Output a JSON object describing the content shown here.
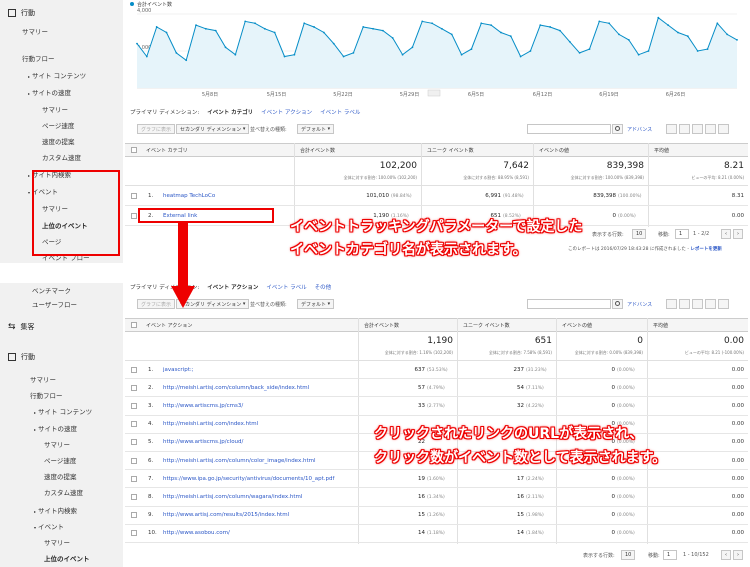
{
  "chart": {
    "legend": "合計イベント数",
    "y_ticks": [
      "4,000",
      "2,000"
    ],
    "x_ticks": [
      "5月8日",
      "5月15日",
      "5月22日",
      "5月29日",
      "6月5日",
      "6月12日",
      "6月19日",
      "6月26日"
    ]
  },
  "chart_data": {
    "type": "area",
    "title": "",
    "series": [
      {
        "name": "合計イベント数",
        "values": [
          2400,
          1700,
          3300,
          3000,
          1900,
          1500,
          3400,
          3200,
          3100,
          2200,
          1800,
          3600,
          3500,
          3200,
          3000,
          1700,
          1800,
          3500,
          3300,
          3000,
          2400,
          1700,
          1900,
          3300,
          3200,
          3100,
          2700,
          1800,
          2200,
          3600,
          3500,
          3200,
          2900,
          1800,
          2100,
          3500,
          3400,
          3000,
          2800,
          1700,
          2000,
          3400,
          3300,
          3100,
          2500,
          1900,
          2100,
          3600,
          3500,
          2900,
          2600,
          1800,
          2000,
          3800,
          3400,
          3000,
          2800,
          2000,
          2100,
          3500,
          2900,
          2600
        ]
      }
    ],
    "ylim": [
      0,
      4000
    ]
  },
  "sidebar_top": {
    "section_icon": "report-icon",
    "section": "行動",
    "items": [
      "サマリー",
      "行動フロー",
      "サイト コンテンツ",
      "サイトの速度",
      "サマリー",
      "ページ速度",
      "速度の提案",
      "カスタム速度",
      "サイト内検索",
      "イベント",
      "サマリー",
      "上位のイベント",
      "ページ",
      "イベント フロー"
    ]
  },
  "table1": {
    "tabs": [
      "プライマリ ディメンション:",
      "イベント カテゴリ",
      "イベント アクション",
      "イベント ラベル"
    ],
    "graph_btn": "グラフに表示",
    "secondary_btn": "セカンダリ ディメンション",
    "sort_label": "並べ替えの種類:",
    "sort_value": "デフォルト",
    "advanced": "アドバンス",
    "headers": [
      "イベント カテゴリ",
      "合計イベント数",
      "ユニーク イベント数",
      "イベントの値",
      "平均値"
    ],
    "totals": [
      {
        "value": "102,200",
        "sub": "全体に対する割合: 100.00% (102,200)"
      },
      {
        "value": "7,642",
        "sub": "全体に対する割合: 88.95% (8,591)"
      },
      {
        "value": "839,398",
        "sub": "全体に対する割合: 100.00% (839,398)"
      },
      {
        "value": "8.21",
        "sub": "ビューの平均: 8.21 (0.00%)"
      }
    ],
    "rows": [
      {
        "idx": "1.",
        "name": "heatmap TechLoCo",
        "total": "101,010",
        "total_pct": "(98.84%)",
        "unique": "6,991",
        "unique_pct": "(91.48%)",
        "value": "839,398",
        "value_pct": "(100.00%)",
        "avg": "8.31"
      },
      {
        "idx": "2.",
        "name": "External link",
        "total": "1,190",
        "total_pct": "(1.16%)",
        "unique": "651",
        "unique_pct": "(8.52%)",
        "value": "0",
        "value_pct": "(0.00%)",
        "avg": "0.00"
      }
    ],
    "rows_label": "表示する行数:",
    "rows_value": "10",
    "move_label": "移動:",
    "move_value": "1",
    "range": "1 - 2/2",
    "created": "このレポートは 2016/07/29 18:43:28 に作成されました - ",
    "refresh": "レポートを更新"
  },
  "sidebar_bottom": {
    "items": [
      "ベンチマーク",
      "ユーザーフロー"
    ],
    "acq_icon": "acquisition-icon",
    "acq": "集客",
    "beh_icon": "report-icon",
    "beh": "行動",
    "beh_items": [
      "サマリー",
      "行動フロー",
      "サイト コンテンツ",
      "サイトの速度",
      "サマリー",
      "ページ速度",
      "速度の提案",
      "カスタム速度",
      "サイト内検索",
      "イベント",
      "サマリー",
      "上位のイベント"
    ]
  },
  "table2": {
    "tabs": [
      "プライマリ ディメンション:",
      "イベント アクション",
      "イベント ラベル",
      "その他"
    ],
    "graph_btn": "グラフに表示",
    "secondary_btn": "セカンダリ ディメンション",
    "sort_label": "並べ替えの種類:",
    "sort_value": "デフォルト",
    "advanced": "アドバンス",
    "headers": [
      "イベント アクション",
      "合計イベント数",
      "ユニーク イベント数",
      "イベントの値",
      "平均値"
    ],
    "totals": [
      {
        "value": "1,190",
        "sub": "全体に対する割合: 1.16% (102,200)"
      },
      {
        "value": "651",
        "sub": "全体に対する割合: 7.58% (8,591)"
      },
      {
        "value": "0",
        "sub": "全体に対する割合: 0.00% (839,398)"
      },
      {
        "value": "0.00",
        "sub": "ビューの平均: 8.21 (-100.00%)"
      }
    ],
    "rows": [
      {
        "idx": "1.",
        "name": "javascript:;",
        "total": "637",
        "total_pct": "(53.53%)",
        "unique": "237",
        "unique_pct": "(31.23%)",
        "value": "0",
        "value_pct": "(0.00%)",
        "avg": "0.00"
      },
      {
        "idx": "2.",
        "name": "http://meishi.artisj.com/column/back_side/index.html",
        "total": "57",
        "total_pct": "(4.79%)",
        "unique": "54",
        "unique_pct": "(7.11%)",
        "value": "0",
        "value_pct": "(0.00%)",
        "avg": "0.00"
      },
      {
        "idx": "3.",
        "name": "http://www.artiscms.jp/cms3/",
        "total": "33",
        "total_pct": "(2.77%)",
        "unique": "32",
        "unique_pct": "(4.22%)",
        "value": "0",
        "value_pct": "(0.00%)",
        "avg": "0.00"
      },
      {
        "idx": "4.",
        "name": "http://meishi.artisj.com/index.html",
        "total": "",
        "total_pct": "",
        "unique": "",
        "unique_pct": "",
        "value": "0",
        "value_pct": "(0.00%)",
        "avg": "0.00"
      },
      {
        "idx": "5.",
        "name": "http://www.artiscms.jp/cloud/",
        "total": "22",
        "total_pct": "",
        "unique": "",
        "unique_pct": "",
        "value": "0",
        "value_pct": "(0.00%)",
        "avg": "0.00"
      },
      {
        "idx": "6.",
        "name": "http://meishi.artisj.com/column/color_image/index.html",
        "total": "22",
        "total_pct": "",
        "unique": "",
        "unique_pct": "",
        "value": "0",
        "value_pct": "(0.00%)",
        "avg": "0.00"
      },
      {
        "idx": "7.",
        "name": "https://www.ipa.go.jp/security/antivirus/documents/10_apt.pdf",
        "total": "19",
        "total_pct": "(1.60%)",
        "unique": "17",
        "unique_pct": "(2.24%)",
        "value": "0",
        "value_pct": "(0.00%)",
        "avg": "0.00"
      },
      {
        "idx": "8.",
        "name": "http://meishi.artisj.com/column/wagara/index.html",
        "total": "16",
        "total_pct": "(1.34%)",
        "unique": "16",
        "unique_pct": "(2.11%)",
        "value": "0",
        "value_pct": "(0.00%)",
        "avg": "0.00"
      },
      {
        "idx": "9.",
        "name": "http://www.artisj.com/results/2015/index.html",
        "total": "15",
        "total_pct": "(1.26%)",
        "unique": "15",
        "unique_pct": "(1.98%)",
        "value": "0",
        "value_pct": "(0.00%)",
        "avg": "0.00"
      },
      {
        "idx": "10.",
        "name": "http://www.asobou.com/",
        "total": "14",
        "total_pct": "(1.18%)",
        "unique": "14",
        "unique_pct": "(1.84%)",
        "value": "0",
        "value_pct": "(0.00%)",
        "avg": "0.00"
      }
    ],
    "rows_label": "表示する行数:",
    "rows_value": "10",
    "move_label": "移動:",
    "move_value": "1",
    "range": "1 - 10/152"
  },
  "annotations": {
    "top_line1": "イベントトラッキングパラメーターで設定した",
    "top_line2": "イベントカテゴリ名が表示されます。",
    "bottom_line1": "クリックされたリンクのURLが表示され、",
    "bottom_line2": "クリック数がイベント数として表示されます。"
  },
  "colors": {
    "line": "#058dc7",
    "area": "#e6f4fa",
    "link": "#2a56c6",
    "annotation": "#e00000"
  }
}
